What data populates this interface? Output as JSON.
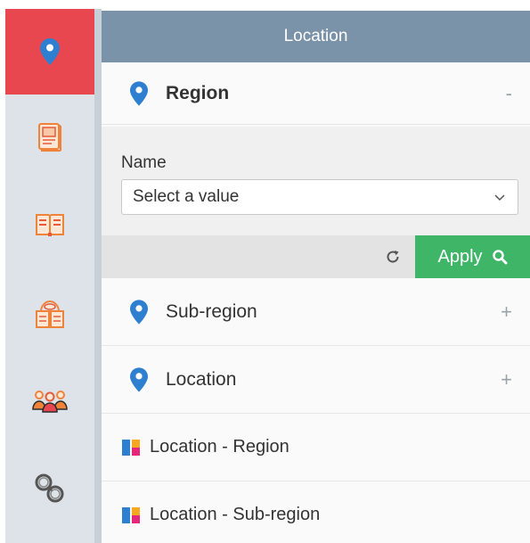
{
  "panel": {
    "title": "Location"
  },
  "rail": {
    "items": [
      {
        "icon": "map-pin-icon",
        "active": true
      },
      {
        "icon": "book-page-icon"
      },
      {
        "icon": "open-book-icon"
      },
      {
        "icon": "reading-book-icon"
      },
      {
        "icon": "people-group-icon"
      },
      {
        "icon": "handcuffs-icon"
      }
    ],
    "colors": {
      "active_bg": "#e9474f",
      "rail_bg": "#dde3e9",
      "icon_orange": "#f0833a"
    }
  },
  "region": {
    "label": "Region",
    "toggle": "-"
  },
  "filter": {
    "name_label": "Name",
    "select_placeholder": "Select a value"
  },
  "actions": {
    "apply_label": "Apply"
  },
  "sections": [
    {
      "label": "Sub-region",
      "toggle": "+"
    },
    {
      "label": "Location",
      "toggle": "+"
    }
  ],
  "reports": [
    {
      "label": "Location - Region"
    },
    {
      "label": "Location - Sub-region"
    }
  ],
  "colors": {
    "header_bg": "#7b93a8",
    "apply_bg": "#3fb567",
    "pin_blue": "#2f7fd0"
  }
}
